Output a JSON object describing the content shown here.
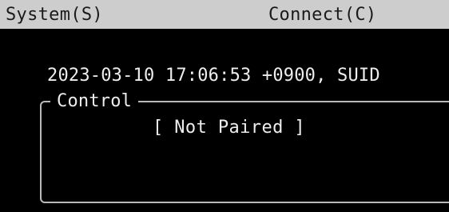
{
  "menubar": {
    "items": [
      {
        "label": "System(S)"
      },
      {
        "label": "Connect(C)"
      }
    ]
  },
  "status": {
    "text": "2023-03-10 17:06:53 +0900, SUID"
  },
  "control_panel": {
    "title": "Control",
    "pair_status": "[ Not Paired ]"
  }
}
